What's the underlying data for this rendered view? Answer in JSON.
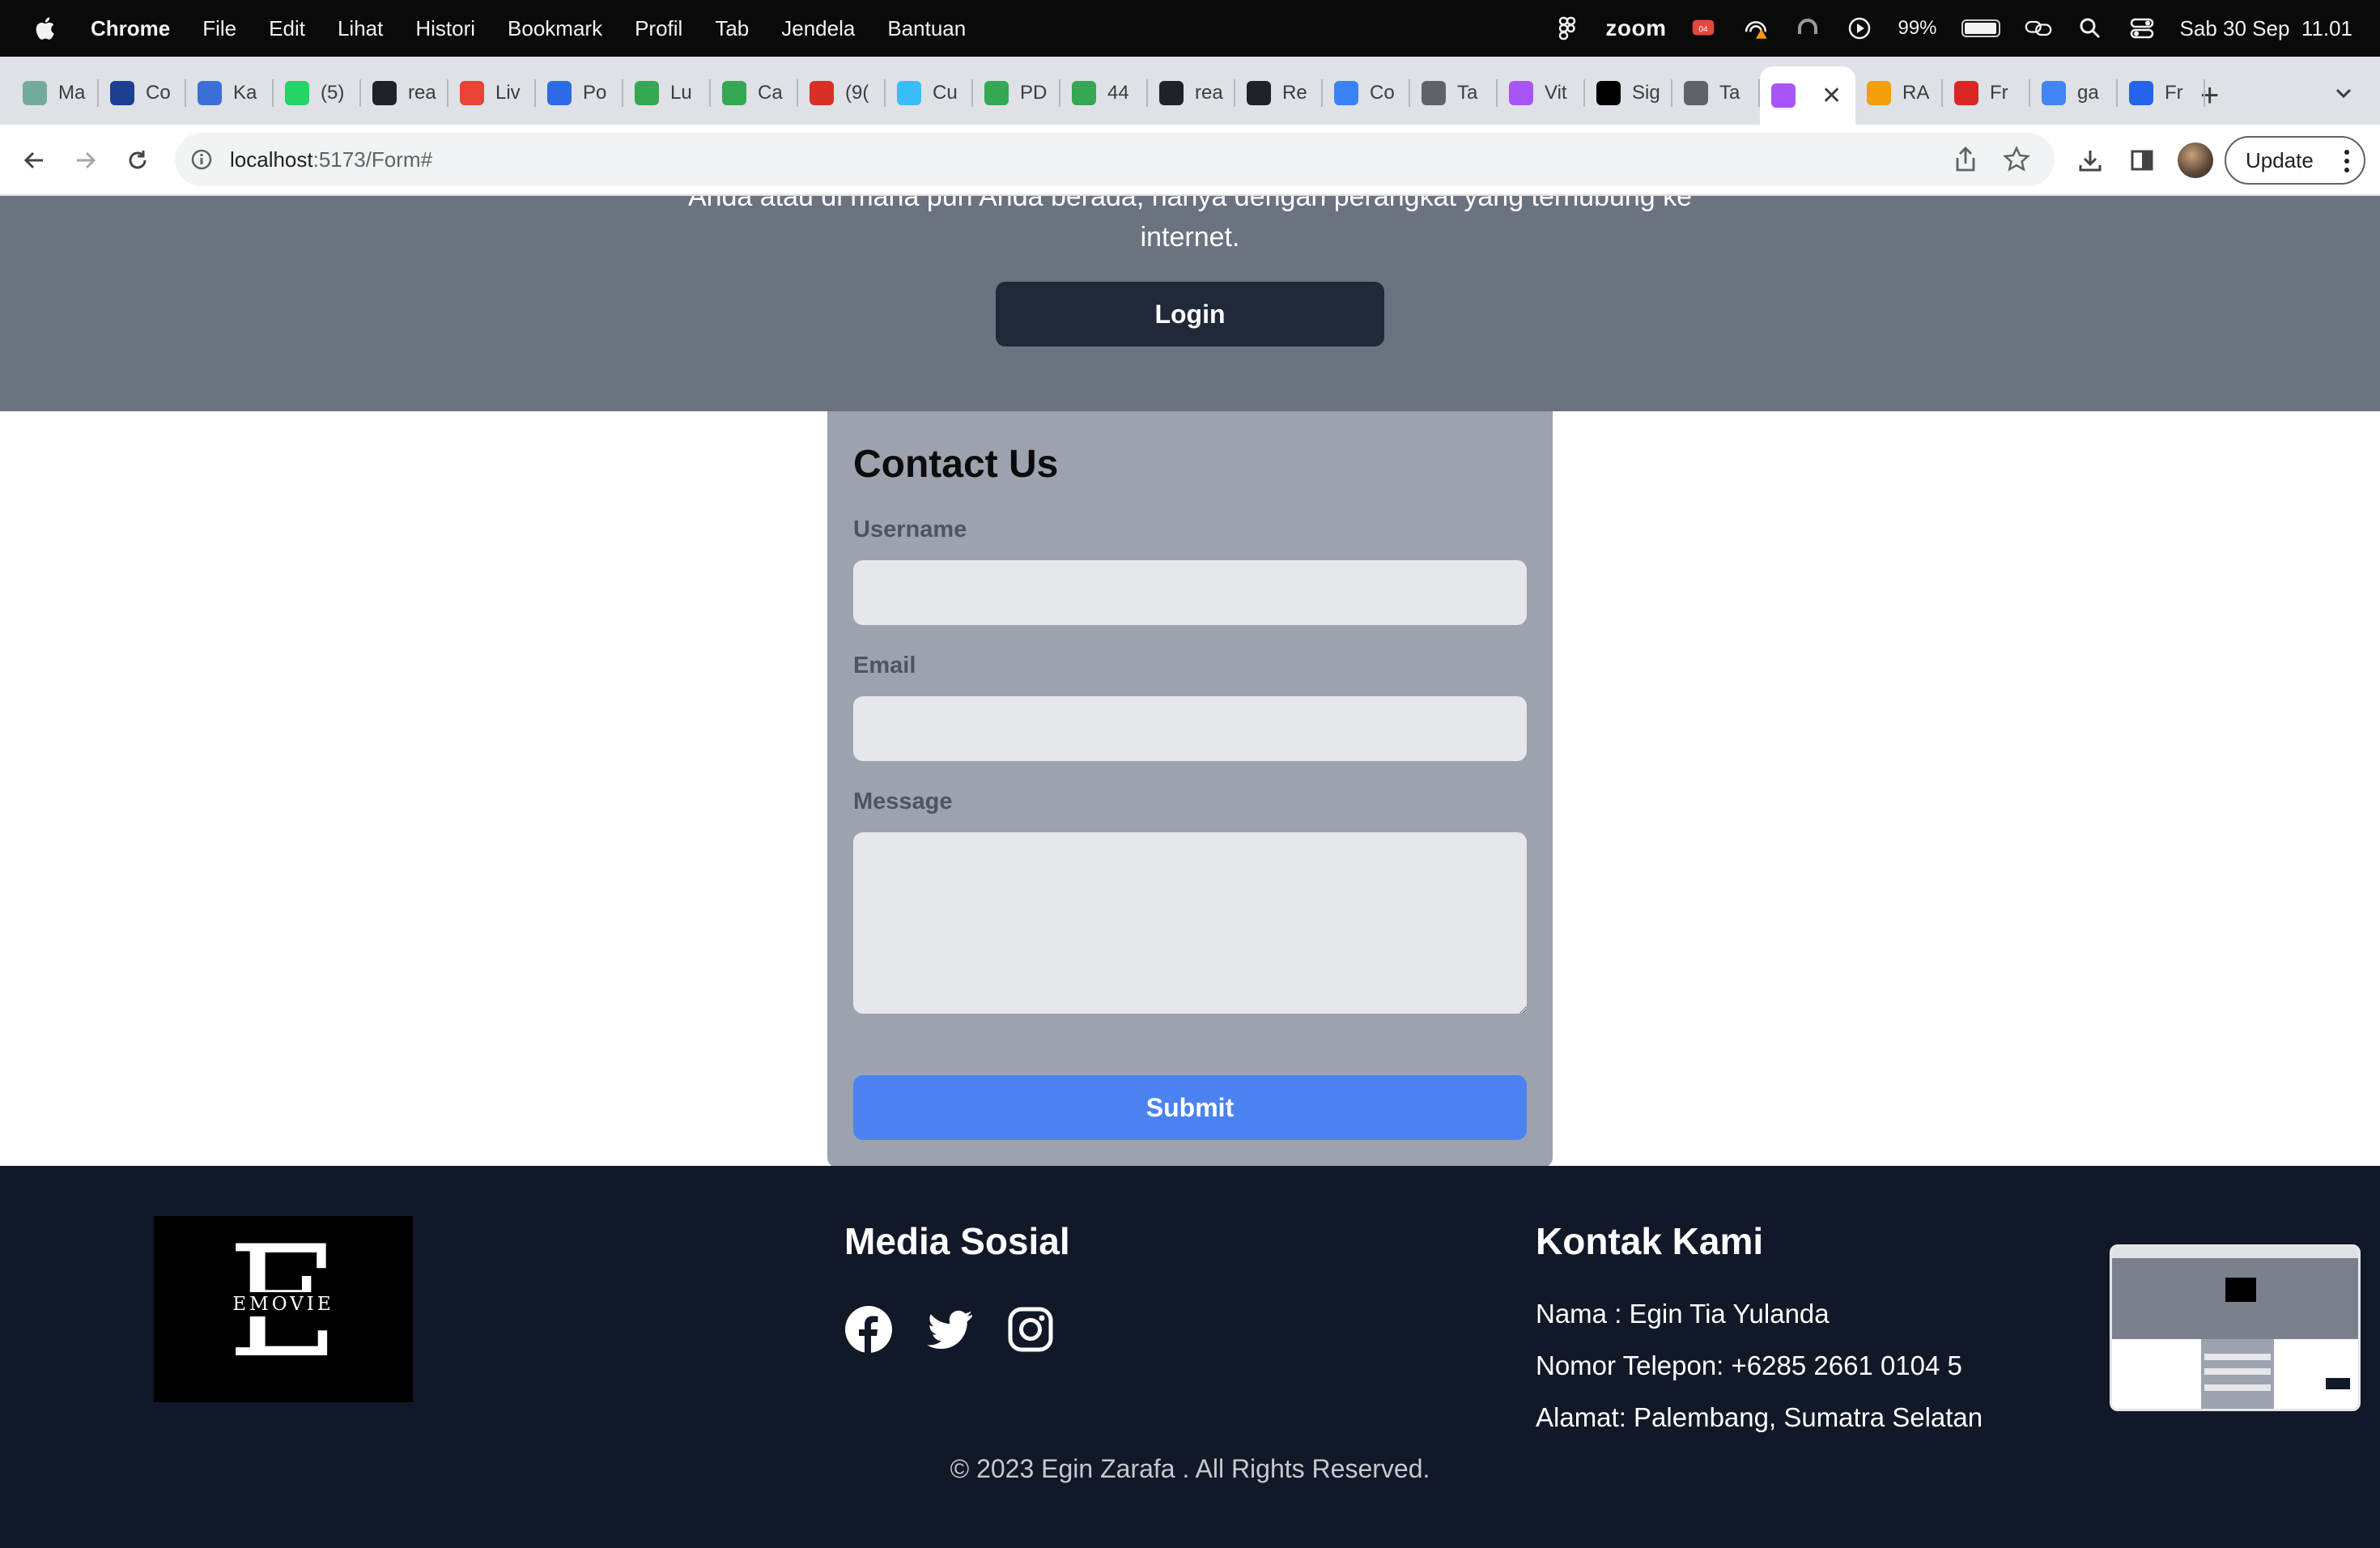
{
  "menubar": {
    "app": "Chrome",
    "items": [
      "File",
      "Edit",
      "Lihat",
      "Histori",
      "Bookmark",
      "Profil",
      "Tab",
      "Jendela",
      "Bantuan"
    ],
    "zoom_label": "zoom",
    "battery": "99%",
    "battery_level": 0.99,
    "datetime": "Sab 30 Sep  11.01",
    "zoom_badge": "04"
  },
  "tabs": [
    {
      "label": "Ma",
      "icon": "chatgpt-icon",
      "color": "#74aa9c"
    },
    {
      "label": "Co",
      "icon": "one-icon",
      "color": "#1c3f94"
    },
    {
      "label": "Ka",
      "icon": "calendar-icon",
      "color": "#3b6fd8"
    },
    {
      "label": "(5)",
      "icon": "whatsapp-icon",
      "color": "#25d366"
    },
    {
      "label": "rea",
      "icon": "github-icon",
      "color": "#1f2328"
    },
    {
      "label": "Liv",
      "icon": "gmail-icon",
      "color": "#ea4335"
    },
    {
      "label": "Po",
      "icon": "zotero-icon",
      "color": "#2d6be4"
    },
    {
      "label": "Lu",
      "icon": "drive-icon",
      "color": "#34a853"
    },
    {
      "label": "Ca",
      "icon": "drive-icon",
      "color": "#34a853"
    },
    {
      "label": "(9(",
      "icon": "badge-909-icon",
      "color": "#d93025"
    },
    {
      "label": "Cu",
      "icon": "tailwind-icon",
      "color": "#38bdf8"
    },
    {
      "label": "PD",
      "icon": "drive-icon",
      "color": "#34a853"
    },
    {
      "label": "44",
      "icon": "drive-upload-icon",
      "color": "#34a853"
    },
    {
      "label": "rea",
      "icon": "github-icon",
      "color": "#1f2328"
    },
    {
      "label": "Re",
      "icon": "github-icon",
      "color": "#1f2328"
    },
    {
      "label": "Co",
      "icon": "react-icon",
      "color": "#3b82f6"
    },
    {
      "label": "Ta",
      "icon": "chrome-icon",
      "color": "#5f6368"
    },
    {
      "label": "Vit",
      "icon": "vite-icon",
      "color": "#a855f7"
    },
    {
      "label": "Sig",
      "icon": "vercel-icon",
      "color": "#000000"
    },
    {
      "label": "Ta",
      "icon": "globe-icon",
      "color": "#5f6368"
    },
    {
      "label": "",
      "icon": "vite-icon",
      "color": "#a855f7",
      "active": true
    },
    {
      "label": "RA",
      "icon": "wallet-icon",
      "color": "#f59e0b"
    },
    {
      "label": "Fr",
      "icon": "s-icon",
      "color": "#dc2626"
    },
    {
      "label": "ga",
      "icon": "google-icon",
      "color": "#4285f4"
    },
    {
      "label": "Fr",
      "icon": "forms-icon",
      "color": "#2563eb"
    }
  ],
  "address": {
    "host": "localhost",
    "path": ":5173/Form#"
  },
  "update_label": "Update",
  "hero": {
    "clipped_text": "Anda atau di mana pun Anda berada, hanya dengan perangkat yang terhubung ke",
    "line2": "internet.",
    "login_label": "Login"
  },
  "contact_form": {
    "title": "Contact Us",
    "username_label": "Username",
    "username_value": "",
    "email_label": "Email",
    "email_value": "",
    "message_label": "Message",
    "message_value": "",
    "submit_label": "Submit"
  },
  "footer": {
    "logo_letter": "E",
    "logo_text": "EMOVIE",
    "social_title": "Media Sosial",
    "social_icons": [
      "facebook-icon",
      "twitter-icon",
      "instagram-icon"
    ],
    "contact_title": "Kontak Kami",
    "name_line": "Nama : Egin Tia Yulanda",
    "phone_line": "Nomor Telepon: +6285 2661 0104 5",
    "address_line": "Alamat: Palembang, Sumatra Selatan",
    "copyright": "© 2023 Egin Zarafa . All Rights Reserved."
  },
  "colors": {
    "hero_bg": "#6b7280",
    "login_bg": "#1f2937",
    "form_bg": "#9ca3af",
    "input_bg": "#e5e7eb",
    "submit_bg": "#4b82ef",
    "footer_bg": "#111827"
  }
}
